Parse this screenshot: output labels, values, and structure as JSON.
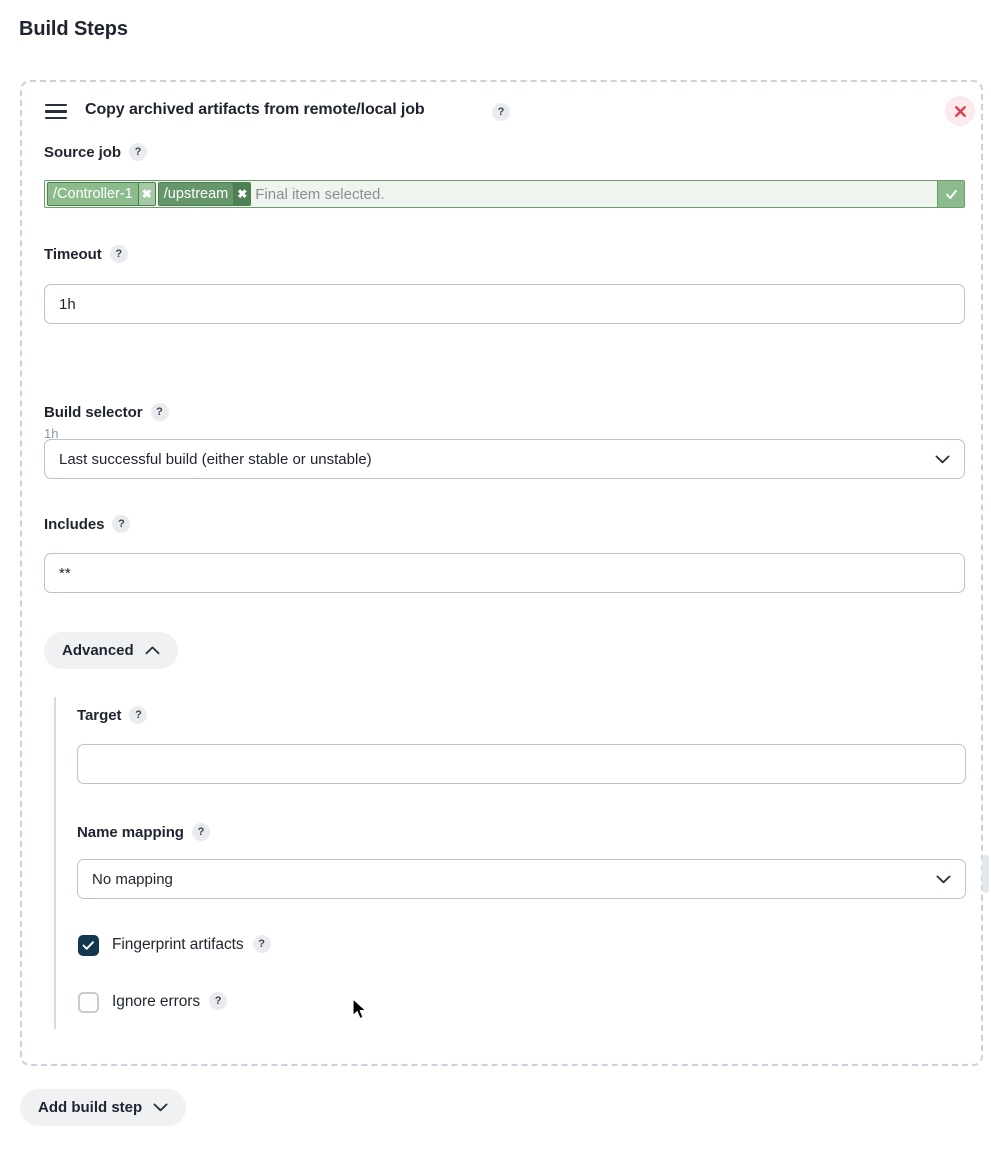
{
  "page": {
    "title": "Build Steps"
  },
  "step": {
    "drag_handle_icon": "drag-handle-icon",
    "title": "Copy archived artifacts from remote/local job",
    "help_icon": "?",
    "close_icon": "close-icon",
    "accent_close_bg": "#fdeaec",
    "accent_close_fg": "#e5384a"
  },
  "source_job": {
    "label": "Source job",
    "help_icon": "?",
    "tokens": [
      {
        "label": "/Controller-1",
        "remove_icon": "✖",
        "style": "light",
        "bg": "#8cbb8c"
      },
      {
        "label": "/upstream",
        "remove_icon": "✖",
        "style": "dark",
        "bg": "#66976a"
      }
    ],
    "placeholder": "Final item selected.",
    "confirm_icon": "check-icon",
    "field_bg": "#eef5ee",
    "field_border": "#6e9a6e"
  },
  "timeout": {
    "label": "Timeout",
    "help_icon": "?",
    "value": "1h",
    "placeholder": "",
    "helper_text": "1h"
  },
  "build_selector": {
    "label": "Build selector",
    "help_icon": "?",
    "value": "Last successful build (either stable or unstable)",
    "chevron_icon": "chevron-down-icon"
  },
  "includes": {
    "label": "Includes",
    "help_icon": "?",
    "value": "**",
    "placeholder": ""
  },
  "advanced": {
    "label": "Advanced",
    "chevron_icon": "chevron-up-icon",
    "expanded": true
  },
  "target": {
    "label": "Target",
    "help_icon": "?",
    "value": "",
    "placeholder": ""
  },
  "name_mapping": {
    "label": "Name mapping",
    "help_icon": "?",
    "value": "No mapping",
    "chevron_icon": "chevron-down-icon"
  },
  "fingerprint": {
    "label": "Fingerprint artifacts",
    "help_icon": "?",
    "checked": true,
    "checked_color": "#13374f"
  },
  "ignore_errors": {
    "label": "Ignore errors",
    "help_icon": "?",
    "checked": false
  },
  "footer": {
    "add_build_step_label": "Add build step",
    "chevron_icon": "chevron-down-icon"
  }
}
